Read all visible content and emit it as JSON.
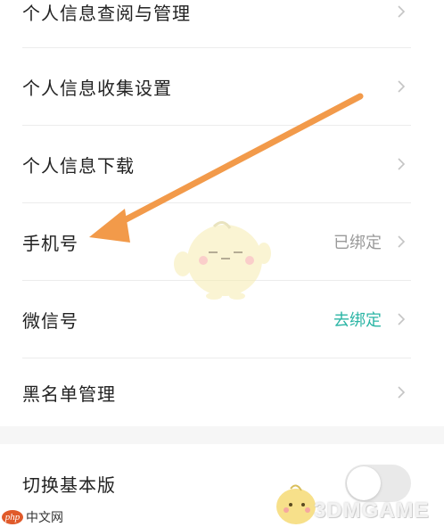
{
  "settings": {
    "items": [
      {
        "label": "个人信息查阅与管理",
        "value": ""
      },
      {
        "label": "个人信息收集设置",
        "value": ""
      },
      {
        "label": "个人信息下载",
        "value": ""
      },
      {
        "label": "手机号",
        "value": "已绑定"
      },
      {
        "label": "微信号",
        "value": "去绑定"
      },
      {
        "label": "黑名单管理",
        "value": ""
      }
    ],
    "basic_mode": {
      "label": "切换基本版",
      "enabled": false
    }
  },
  "colors": {
    "value_muted": "#9a9a9a",
    "value_accent": "#2bb5a5",
    "arrow": "#f29a4a",
    "toggle_track": "#e9e9e9"
  },
  "icons": [
    "chevron-right-icon",
    "arrow-annotation",
    "mascot-watermark"
  ],
  "watermarks": {
    "php_badge": "php",
    "php_site": "中文网",
    "game_site": "3DMGAME"
  }
}
